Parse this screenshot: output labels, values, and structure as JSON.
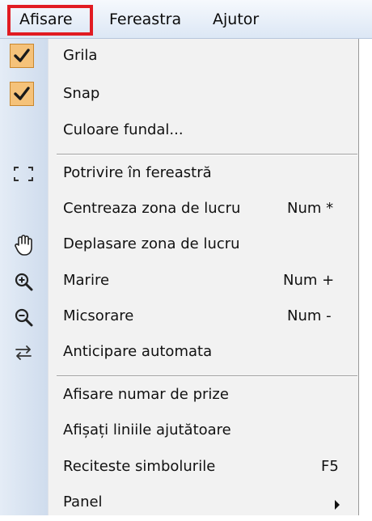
{
  "menubar": {
    "items": [
      "Afisare",
      "Fereastra",
      "Ajutor"
    ],
    "highlight_color": "#e11b22"
  },
  "menu": {
    "items": [
      {
        "label": "Grila",
        "checked": true,
        "icon": "checkmark-icon"
      },
      {
        "label": "Snap",
        "checked": true,
        "icon": "checkmark-icon"
      },
      {
        "label": "Culoare fundal...",
        "icon": ""
      },
      {
        "label": "Potrivire în fereastră",
        "icon": "fit-window-icon"
      },
      {
        "label": "Centreaza zona de lucru",
        "shortcut": "Num *"
      },
      {
        "label": "Deplasare zona de lucru",
        "icon": "hand-pan-icon"
      },
      {
        "label": "Marire",
        "shortcut": "Num +",
        "icon": "zoom-in-icon"
      },
      {
        "label": "Micsorare",
        "shortcut": "Num -",
        "icon": "zoom-out-icon"
      },
      {
        "label": "Anticipare automata",
        "icon": "auto-anticipate-icon"
      },
      {
        "label": "Afisare numar de prize"
      },
      {
        "label": "Afișați liniile ajutătoare"
      },
      {
        "label": "Reciteste simbolurile",
        "shortcut": "F5"
      },
      {
        "label": "Panel",
        "submenu": true,
        "icon": "submenu-arrow-icon"
      }
    ]
  },
  "colors": {
    "checkbox_bg": "#f5c27a",
    "check_mark": "#1a1a1a",
    "gutter": "#d6e2f0"
  }
}
